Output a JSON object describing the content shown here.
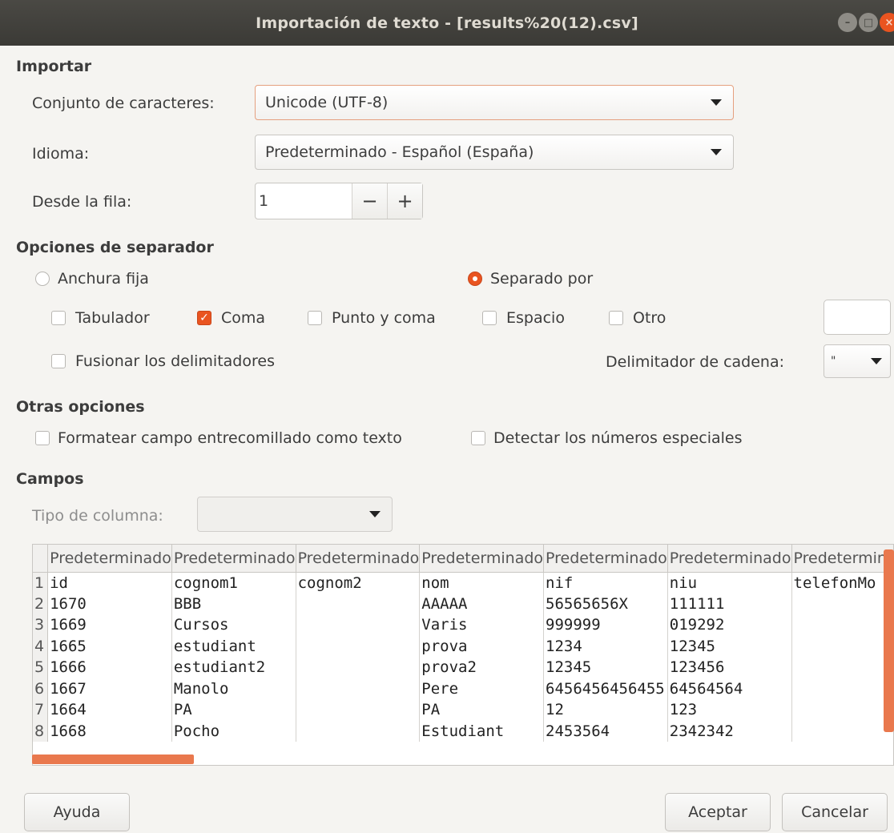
{
  "window": {
    "title": "Importación de texto - [results%20(12).csv]"
  },
  "import": {
    "section": "Importar",
    "charset_label": "Conjunto de caracteres:",
    "charset_value": "Unicode (UTF-8)",
    "language_label": "Idioma:",
    "language_value": "Predeterminado - Español (España)",
    "from_row_label": "Desde la fila:",
    "from_row_value": "1",
    "minus": "−",
    "plus": "+"
  },
  "separator": {
    "section": "Opciones de separador",
    "fixed_width": "Anchura fija",
    "separated_by": "Separado por",
    "tab": "Tabulador",
    "comma": "Coma",
    "semicolon": "Punto y coma",
    "space": "Espacio",
    "other": "Otro",
    "merge": "Fusionar los delimitadores",
    "string_delim_label": "Delimitador de cadena:",
    "string_delim_value": "\""
  },
  "other": {
    "section": "Otras opciones",
    "quoted_as_text": "Formatear campo entrecomillado como texto",
    "special_numbers": "Detectar los números especiales"
  },
  "fields": {
    "section": "Campos",
    "column_type_label": "Tipo de columna:",
    "headers": [
      "Predeterminado",
      "Predeterminado",
      "Predeterminado",
      "Predeterminado",
      "Predeterminado",
      "Predeterminado",
      "Predeterminado"
    ],
    "rows": [
      {
        "n": "1",
        "cells": [
          "id",
          "cognom1",
          "cognom2",
          "nom",
          "nif",
          "niu",
          "telefonMo"
        ]
      },
      {
        "n": "2",
        "cells": [
          "1670",
          "BBB",
          "",
          "AAAAA",
          "56565656X",
          "111111",
          ""
        ]
      },
      {
        "n": "3",
        "cells": [
          "1669",
          "Cursos",
          "",
          "Varis",
          "999999",
          "019292",
          ""
        ]
      },
      {
        "n": "4",
        "cells": [
          "1665",
          "estudiant",
          "",
          "prova",
          "1234",
          "12345",
          ""
        ]
      },
      {
        "n": "5",
        "cells": [
          "1666",
          "estudiant2",
          "",
          "prova2",
          "12345",
          "123456",
          ""
        ]
      },
      {
        "n": "6",
        "cells": [
          "1667",
          "Manolo",
          "",
          "Pere",
          "6456456456455",
          "64564564",
          ""
        ]
      },
      {
        "n": "7",
        "cells": [
          "1664",
          "PA",
          "",
          "PA",
          "12",
          "123",
          ""
        ]
      },
      {
        "n": "8",
        "cells": [
          "1668",
          "Pocho",
          "",
          "Estudiant",
          "2453564",
          "2342342",
          ""
        ]
      }
    ]
  },
  "buttons": {
    "help": "Ayuda",
    "ok": "Aceptar",
    "cancel": "Cancelar"
  },
  "colors": {
    "accent": "#e95420",
    "titlebar": "#3b3a36"
  }
}
